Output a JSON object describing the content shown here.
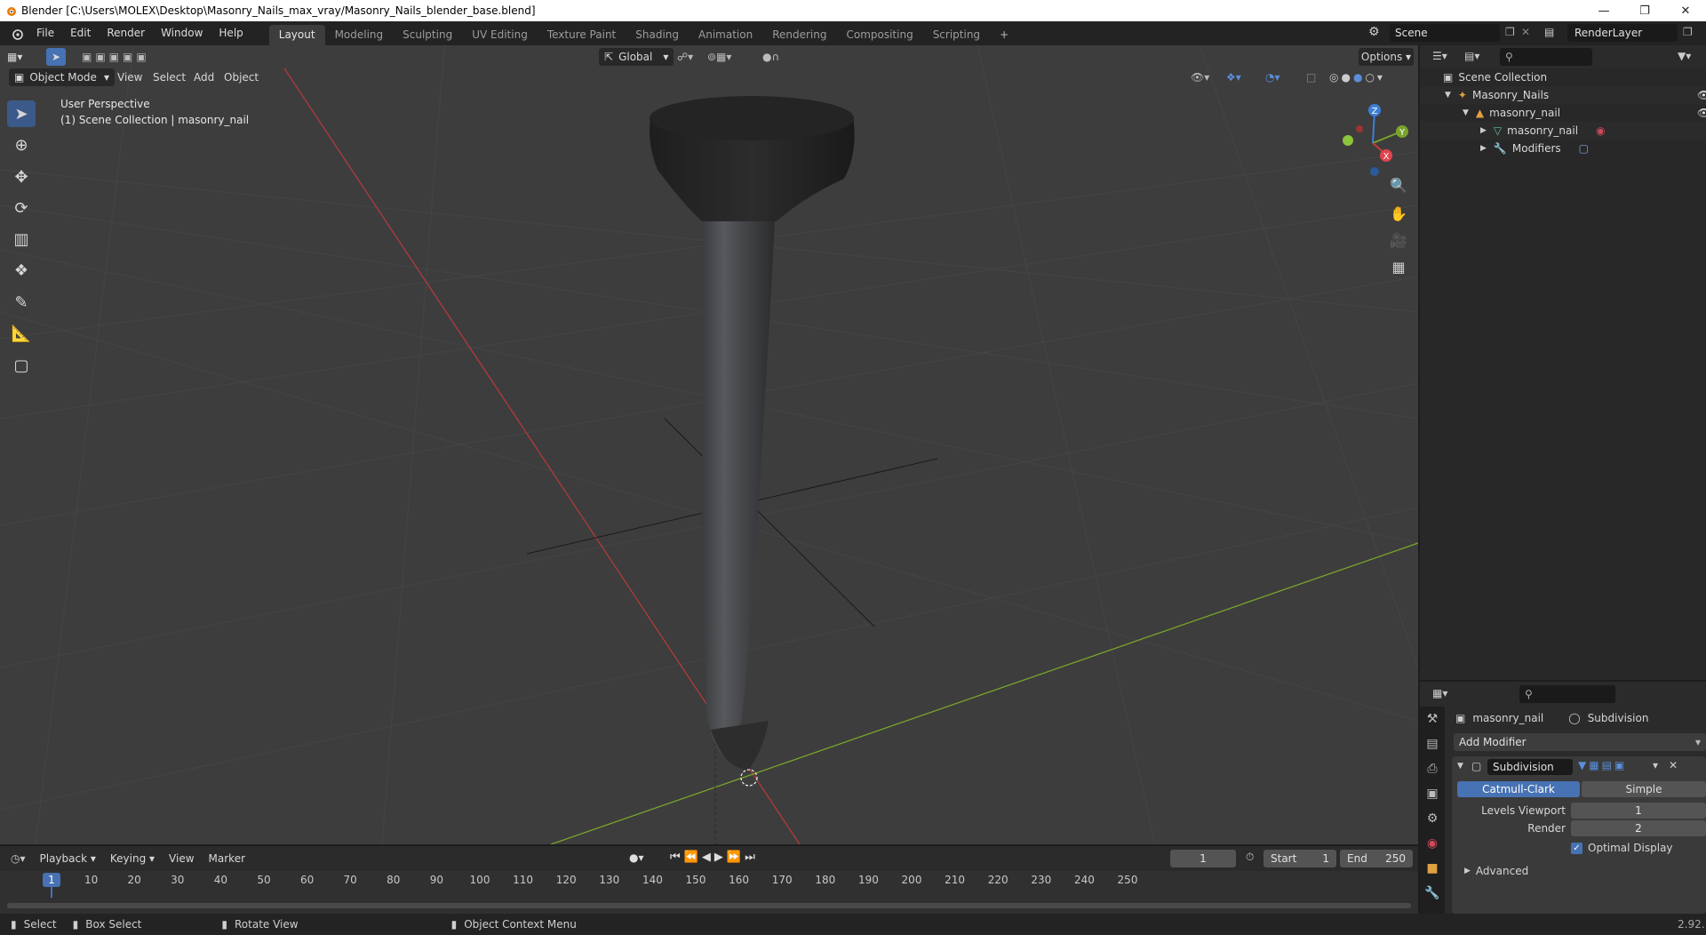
{
  "window": {
    "title": "Blender [C:\\Users\\MOLEX\\Desktop\\Masonry_Nails_max_vray/Masonry_Nails_blender_base.blend]"
  },
  "topbar": {
    "menus": [
      "File",
      "Edit",
      "Render",
      "Window",
      "Help"
    ],
    "workspaces": [
      "Layout",
      "Modeling",
      "Sculpting",
      "UV Editing",
      "Texture Paint",
      "Shading",
      "Animation",
      "Rendering",
      "Compositing",
      "Scripting"
    ],
    "active_workspace": "Layout",
    "add_tab": "+",
    "scene_name": "Scene",
    "view_layer": "RenderLayer"
  },
  "viewport": {
    "mode": "Object Mode",
    "menus": [
      "View",
      "Select",
      "Add",
      "Object"
    ],
    "transform_orientation": "Global",
    "options_label": "Options",
    "overlay_title": "User Perspective",
    "overlay_subtitle": "(1) Scene Collection | masonry_nail",
    "gizmo_axes": {
      "z": "Z",
      "y": "Y",
      "x": "X"
    }
  },
  "timeline": {
    "menus": [
      "Playback",
      "Keying",
      "View",
      "Marker"
    ],
    "current_frame": "1",
    "start_label": "Start",
    "start_value": "1",
    "end_label": "End",
    "end_value": "250",
    "ticks": [
      "1",
      "10",
      "20",
      "30",
      "40",
      "50",
      "60",
      "70",
      "80",
      "90",
      "100",
      "110",
      "120",
      "130",
      "140",
      "150",
      "160",
      "170",
      "180",
      "190",
      "200",
      "210",
      "220",
      "230",
      "240",
      "250"
    ]
  },
  "statusbar": {
    "select": "Select",
    "box_select": "Box Select",
    "rotate_view": "Rotate View",
    "context_menu": "Object Context Menu",
    "version": "2.92."
  },
  "outliner": {
    "root": "Scene Collection",
    "collection": "Masonry_Nails",
    "object": "masonry_nail",
    "mesh": "masonry_nail",
    "modifiers": "Modifiers"
  },
  "properties": {
    "object_name": "masonry_nail",
    "modifier_context": "Subdivision",
    "add_modifier": "Add Modifier",
    "modifier_name": "Subdivision",
    "catmull_clark": "Catmull-Clark",
    "simple": "Simple",
    "levels_viewport_label": "Levels Viewport",
    "levels_viewport_value": "1",
    "render_label": "Render",
    "render_value": "2",
    "optimal_display": "Optimal Display",
    "advanced": "Advanced"
  },
  "colors": {
    "accent": "#4772b3",
    "x_axis": "#c53b3b",
    "y_axis": "#7aa32b",
    "z_axis": "#3b7fd8",
    "viewport_bg": "#3d3d3d"
  }
}
